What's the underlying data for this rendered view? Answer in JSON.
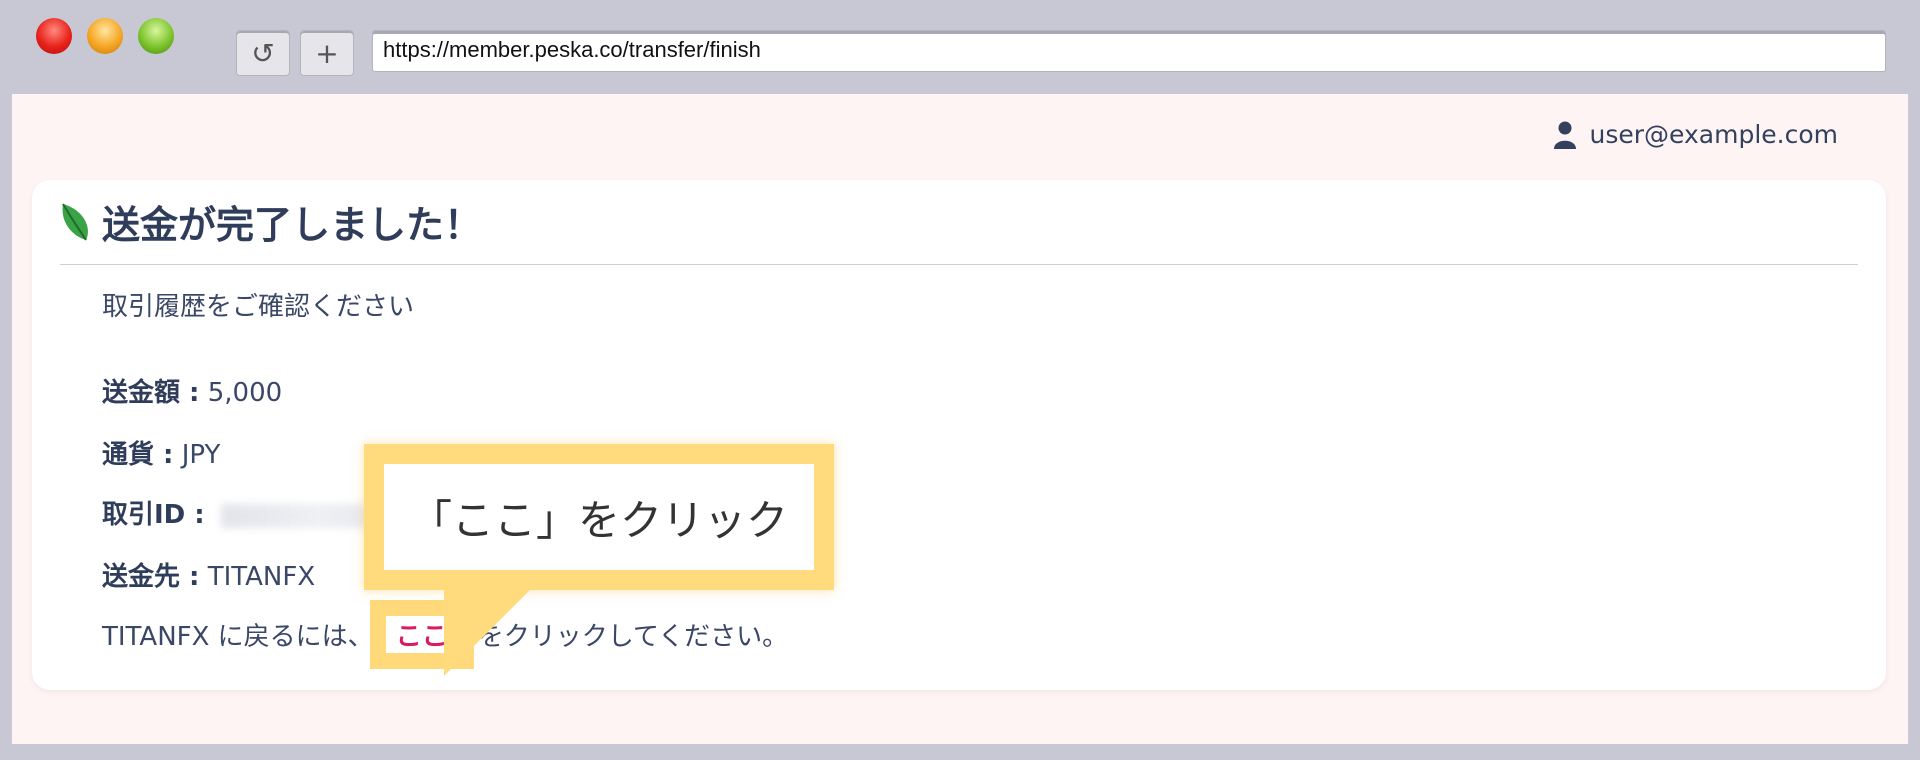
{
  "browser": {
    "url": "https://member.peska.co/transfer/finish",
    "reload_icon": "↺",
    "newtab_icon": "+"
  },
  "header": {
    "user_email": "user@example.com"
  },
  "card": {
    "title": "送金が完了しました！",
    "subtitle": "取引履歴をご確認ください",
    "amount_label": "送金額 :",
    "amount_value": "5,000",
    "currency_label": "通貨 :",
    "currency_value": "JPY",
    "txid_label": "取引ID :",
    "destination_label": "送金先 :",
    "destination_value": "TITANFX",
    "back_prefix": "TITANFX に戻るには、",
    "back_link": "ここ",
    "back_suffix": "をクリックしてください。"
  },
  "callout": {
    "text": "「ここ」をクリック"
  },
  "colors": {
    "accent_link": "#d81b60",
    "callout_border": "#ffdb7e",
    "page_bg": "#fef4f4",
    "text_main": "#2f3d5a"
  }
}
